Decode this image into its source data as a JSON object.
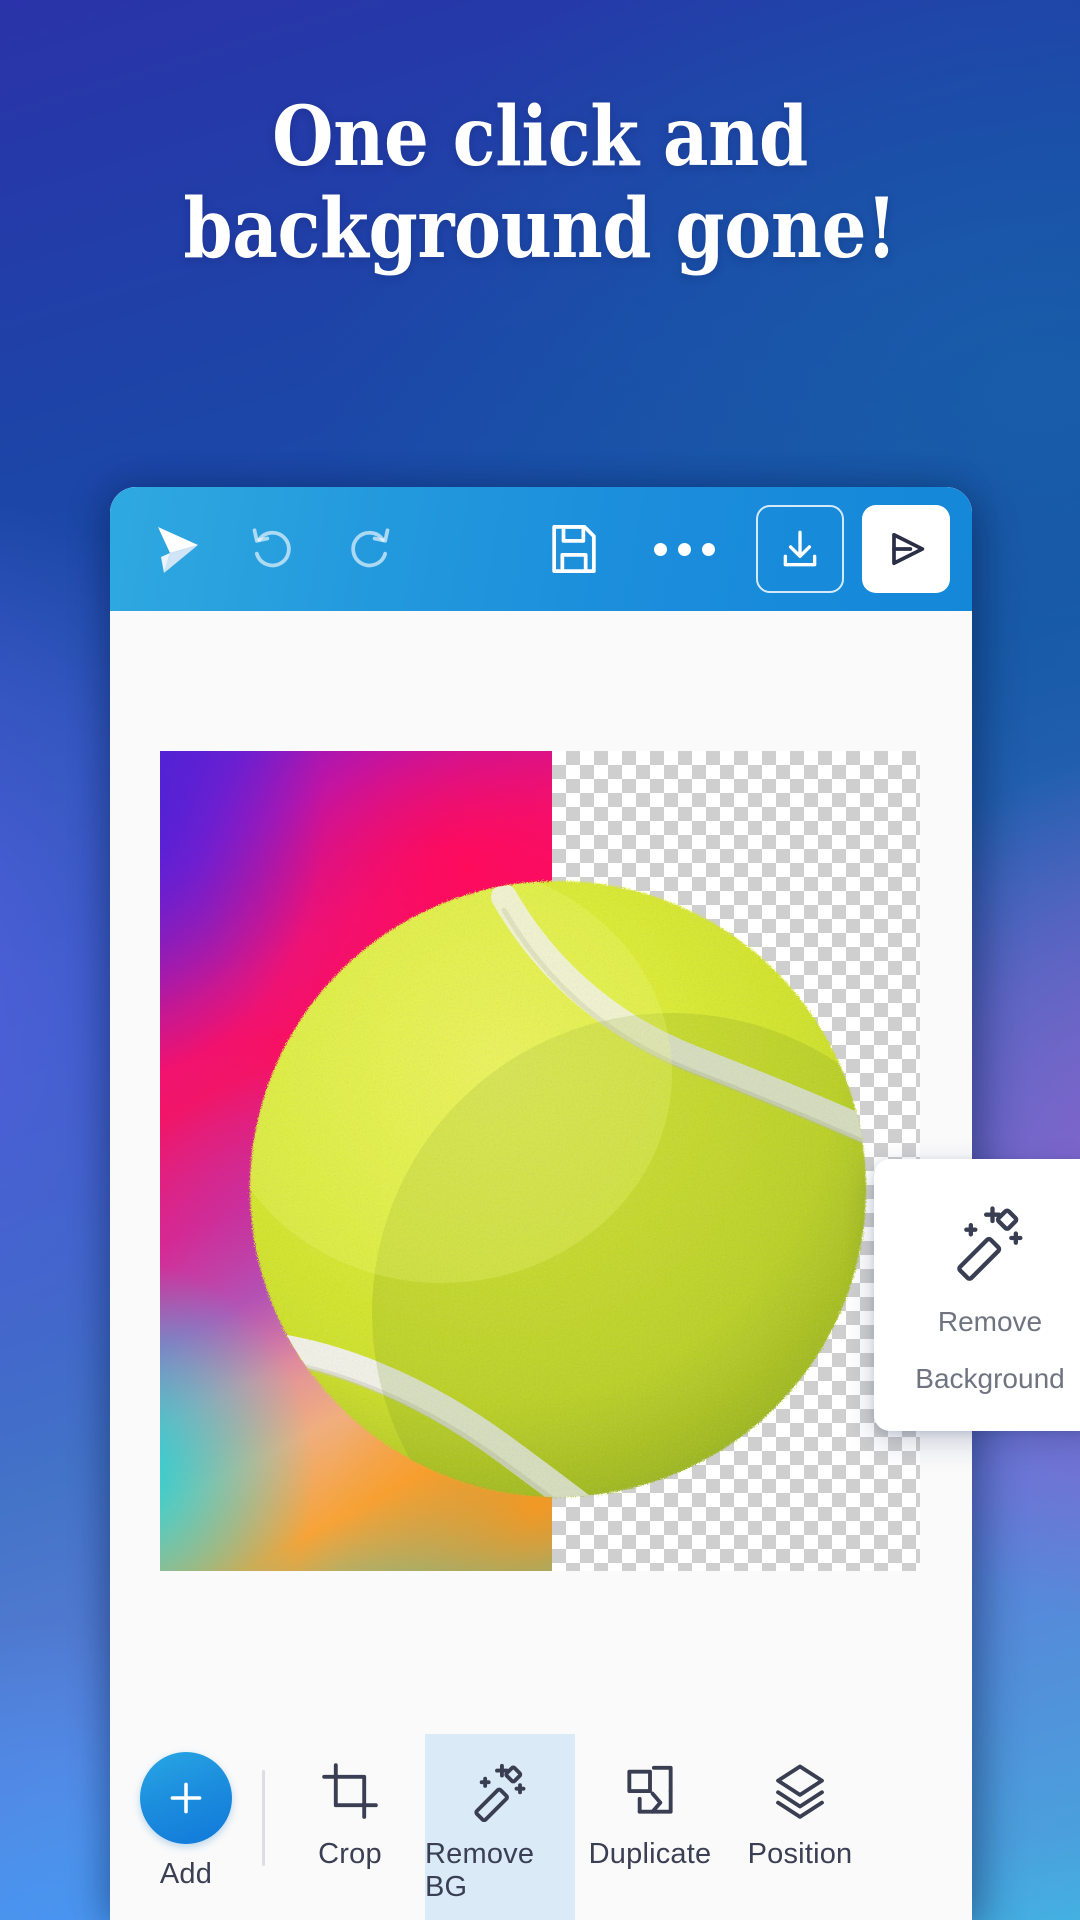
{
  "headline": {
    "line1": "One click and",
    "line2": "background gone!"
  },
  "app": {
    "toolbar": {
      "logo_label": "app-logo",
      "undo_label": "Undo",
      "redo_label": "Redo",
      "save_label": "Save",
      "more_label": "More",
      "download_label": "Download",
      "share_label": "Share"
    },
    "tooltip_card": {
      "line1": "Remove",
      "line2": "Background",
      "icon": "magic-wand-icon"
    },
    "bottom_bar": {
      "items": [
        {
          "label": "Add",
          "icon": "plus-icon",
          "selected": false
        },
        {
          "label": "Crop",
          "icon": "crop-icon",
          "selected": false
        },
        {
          "label": "Remove BG",
          "icon": "magic-wand-icon",
          "selected": true
        },
        {
          "label": "Duplicate",
          "icon": "duplicate-icon",
          "selected": false
        },
        {
          "label": "Position",
          "icon": "layers-icon",
          "selected": false
        }
      ]
    },
    "canvas": {
      "subject": "tennis-ball",
      "left_half": "gradient-background",
      "right_half": "transparent-checkerboard"
    }
  },
  "colors": {
    "brand_blue": "#1b8ddb",
    "accent_blue": "#29a7e4",
    "selected_tool_bg": "#daeaf7",
    "icon_dark": "#3a3e52",
    "card_text": "#6f7480",
    "headline_text": "#ffffff"
  }
}
